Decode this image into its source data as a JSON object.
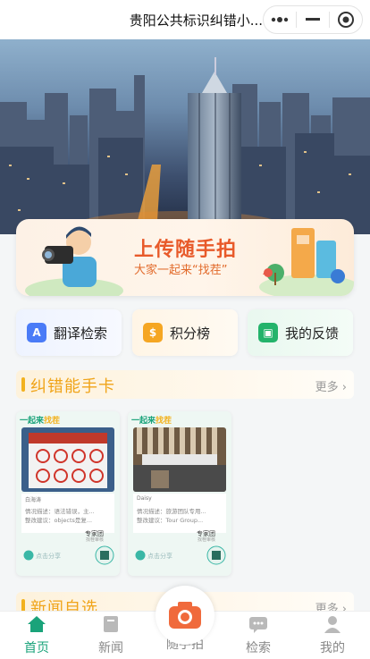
{
  "window": {
    "title": "贵阳公共标识纠错小..."
  },
  "upload_banner": {
    "title": "上传随手拍",
    "subtitle": "大家一起来“找茬”"
  },
  "quick_entries": [
    {
      "label": "翻译检索",
      "icon": "translate-icon",
      "color": "#4a7bf7"
    },
    {
      "label": "积分榜",
      "icon": "points-icon",
      "color": "#f5a623"
    },
    {
      "label": "我的反馈",
      "icon": "feedback-icon",
      "color": "#24b36b"
    }
  ],
  "section_correction": {
    "title": "纠错能手卡",
    "more": "更多 ›"
  },
  "cards": [
    {
      "header_prefix": "一起来",
      "header_highlight": "找茬",
      "user": "白海涛",
      "line1": "情况描述：语法错误，主...",
      "line2": "整改建议：objects是复...",
      "team": "专家团",
      "team_sub": "找茬审核",
      "share": "点击分享"
    },
    {
      "header_prefix": "一起来",
      "header_highlight": "找茬",
      "user": "Daisy",
      "line1": "情况描述：旅游团队专用...",
      "line2": "整改建议：Tour Group...",
      "team": "专家团",
      "team_sub": "找茬审核",
      "share": "点击分享"
    }
  ],
  "section_news": {
    "title": "新闻自选",
    "more": "更多 ›"
  },
  "tabbar": {
    "tabs": [
      {
        "label": "首页",
        "icon": "home-icon",
        "active": true
      },
      {
        "label": "新闻",
        "icon": "news-icon",
        "active": false
      },
      {
        "label": "随手拍",
        "icon": "camera-icon",
        "active": false
      },
      {
        "label": "检索",
        "icon": "search-chat-icon",
        "active": false
      },
      {
        "label": "我的",
        "icon": "profile-icon",
        "active": false
      }
    ]
  },
  "colors": {
    "accent": "#1aa37a",
    "highlight": "#f0a419",
    "banner_text": "#e85a2a"
  }
}
